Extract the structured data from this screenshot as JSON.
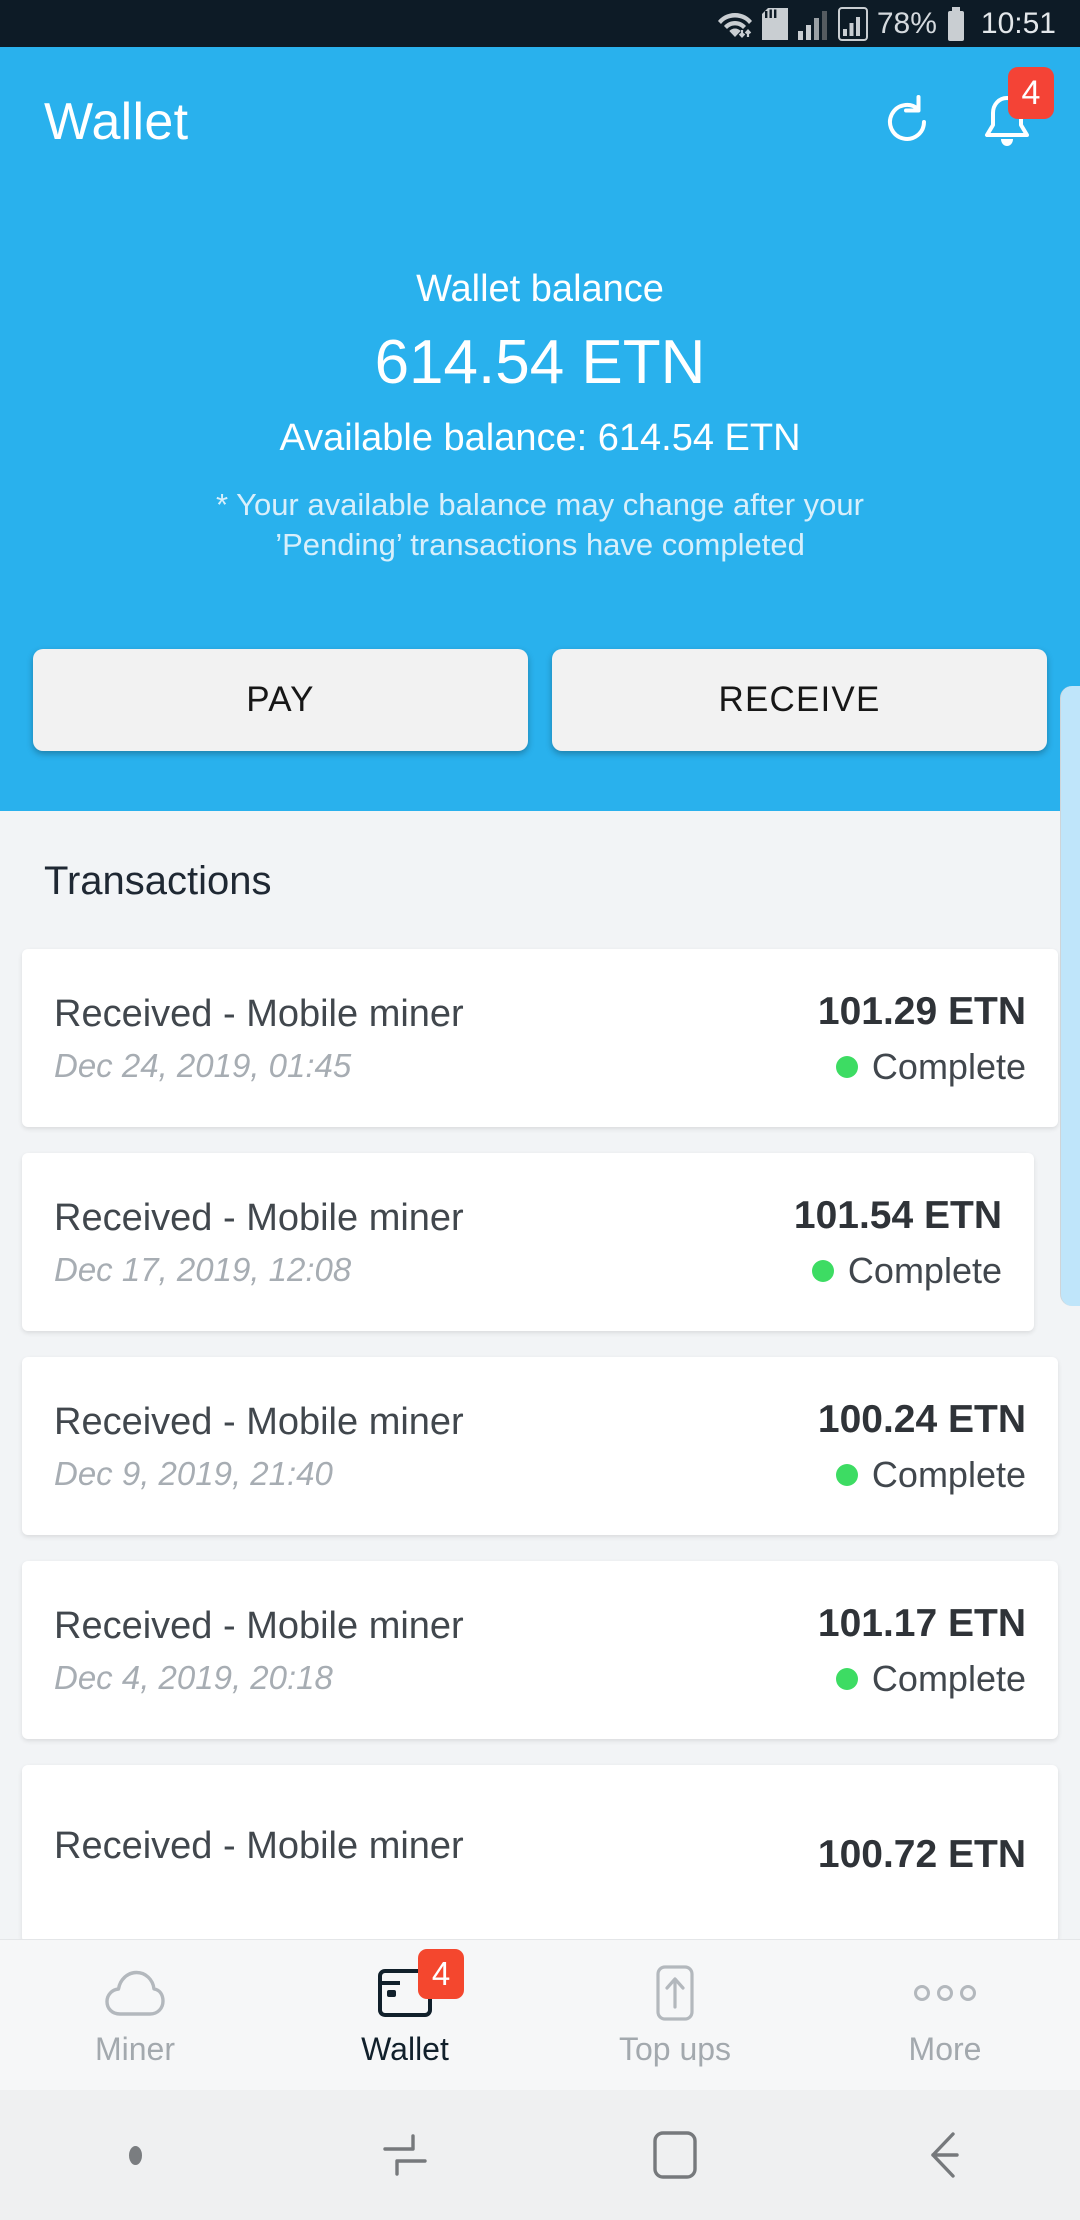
{
  "status_bar": {
    "battery_percent": "78%",
    "clock": "10:51",
    "icons": [
      "wifi-icon",
      "sd-card-icon",
      "signal-1-icon",
      "signal-2-icon",
      "battery-icon"
    ]
  },
  "appbar": {
    "title": "Wallet",
    "refresh_icon": "refresh-icon",
    "notification_icon": "bell-icon",
    "notification_count": "4",
    "background_color": "#29b1ed"
  },
  "balance": {
    "label": "Wallet balance",
    "amount": "614.54 ETN",
    "available": "Available balance: 614.54 ETN",
    "note": "* Your available balance may change after your ’Pending’ transactions have completed"
  },
  "actions": {
    "pay_label": "PAY",
    "receive_label": "RECEIVE"
  },
  "transactions": {
    "heading": "Transactions",
    "status_color": "#3ddc63",
    "items": [
      {
        "title": "Received - Mobile miner",
        "date": "Dec 24, 2019, 01:45",
        "amount": "101.29 ETN",
        "status": "Complete"
      },
      {
        "title": "Received - Mobile miner",
        "date": "Dec 17, 2019, 12:08",
        "amount": "101.54 ETN",
        "status": "Complete"
      },
      {
        "title": "Received - Mobile miner",
        "date": "Dec 9, 2019, 21:40",
        "amount": "100.24 ETN",
        "status": "Complete"
      },
      {
        "title": "Received - Mobile miner",
        "date": "Dec 4, 2019, 20:18",
        "amount": "101.17 ETN",
        "status": "Complete"
      },
      {
        "title": "Received - Mobile miner",
        "date": "",
        "amount": "100.72 ETN",
        "status": ""
      }
    ]
  },
  "bottom_nav": {
    "items": [
      {
        "label": "Miner",
        "icon": "cloud-icon",
        "active": false,
        "badge": ""
      },
      {
        "label": "Wallet",
        "icon": "wallet-icon",
        "active": true,
        "badge": "4"
      },
      {
        "label": "Top ups",
        "icon": "phone-up-arrow-icon",
        "active": false,
        "badge": ""
      },
      {
        "label": "More",
        "icon": "more-dots-icon",
        "active": false,
        "badge": ""
      }
    ],
    "badge_color": "#f4472e"
  },
  "system_nav": {
    "items": [
      "dot-indicator",
      "recents-icon",
      "home-icon",
      "back-icon"
    ]
  }
}
